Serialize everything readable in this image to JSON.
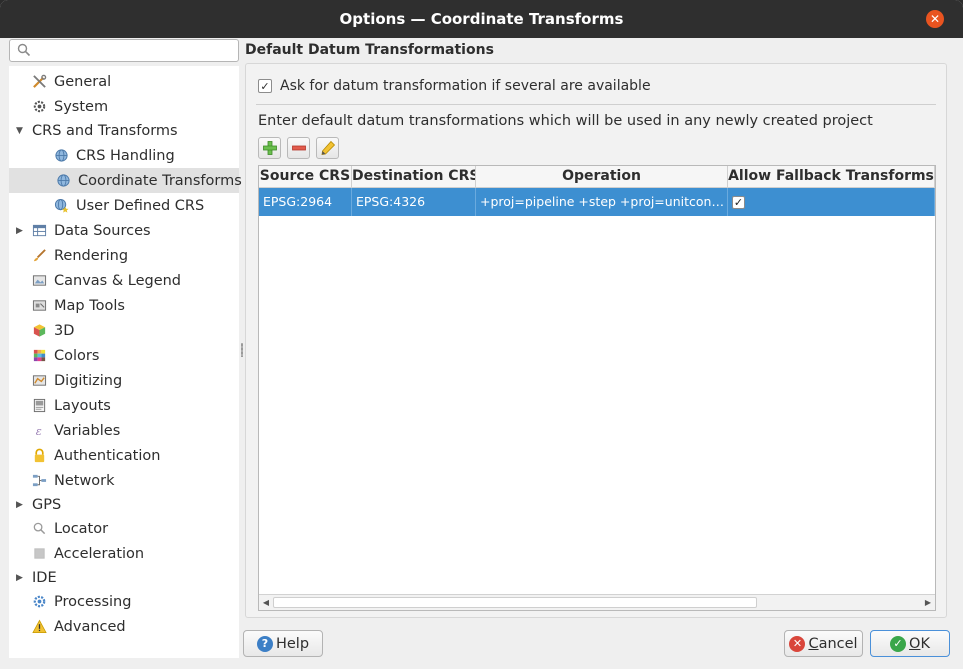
{
  "window": {
    "title": "Options — Coordinate Transforms"
  },
  "search": {
    "placeholder": "",
    "value": ""
  },
  "sidebar": {
    "items": [
      {
        "label": "General",
        "icon": "tools-icon"
      },
      {
        "label": "System",
        "icon": "gear-icon"
      },
      {
        "label": "CRS and Transforms",
        "icon": ""
      },
      {
        "label": "CRS Handling",
        "icon": "globe-icon"
      },
      {
        "label": "Coordinate Transforms",
        "icon": "globe-icon"
      },
      {
        "label": "User Defined CRS",
        "icon": "globe-star-icon"
      },
      {
        "label": "Data Sources",
        "icon": "table-icon"
      },
      {
        "label": "Rendering",
        "icon": "brush-icon"
      },
      {
        "label": "Canvas & Legend",
        "icon": "canvas-icon"
      },
      {
        "label": "Map Tools",
        "icon": "map-tools-icon"
      },
      {
        "label": "3D",
        "icon": "cube-icon"
      },
      {
        "label": "Colors",
        "icon": "palette-icon"
      },
      {
        "label": "Digitizing",
        "icon": "digitizing-icon"
      },
      {
        "label": "Layouts",
        "icon": "layout-icon"
      },
      {
        "label": "Variables",
        "icon": "variables-icon"
      },
      {
        "label": "Authentication",
        "icon": "lock-icon"
      },
      {
        "label": "Network",
        "icon": "network-icon"
      },
      {
        "label": "GPS",
        "icon": ""
      },
      {
        "label": "Locator",
        "icon": "search-icon"
      },
      {
        "label": "Acceleration",
        "icon": "chip-icon"
      },
      {
        "label": "IDE",
        "icon": ""
      },
      {
        "label": "Processing",
        "icon": "gear-icon"
      },
      {
        "label": "Advanced",
        "icon": "warning-icon"
      }
    ]
  },
  "main": {
    "section_title": "Default Datum Transformations",
    "ask_checkbox": {
      "label": "Ask for datum transformation if several are available",
      "checked": true
    },
    "description": "Enter default datum transformations which will be used in any newly created project",
    "toolbar": {
      "add_icon": "add-icon",
      "remove_icon": "remove-icon",
      "edit_icon": "edit-icon"
    },
    "table": {
      "columns": [
        "Source CRS",
        "Destination CRS",
        "Operation",
        "Allow Fallback Transforms"
      ],
      "rows": [
        {
          "source": "EPSG:2964",
          "destination": "EPSG:4326",
          "operation": "+proj=pipeline +step +proj=unitconvert…",
          "fallback": true
        }
      ]
    }
  },
  "buttons": {
    "help": "Help",
    "cancel_prefix": "",
    "cancel_underlined": "C",
    "cancel_rest": "ancel",
    "ok_underlined": "O",
    "ok_rest": "K"
  },
  "colors": {
    "accent": "#3d8fd1",
    "close": "#e95420",
    "titlebar": "#2f2f2f"
  }
}
